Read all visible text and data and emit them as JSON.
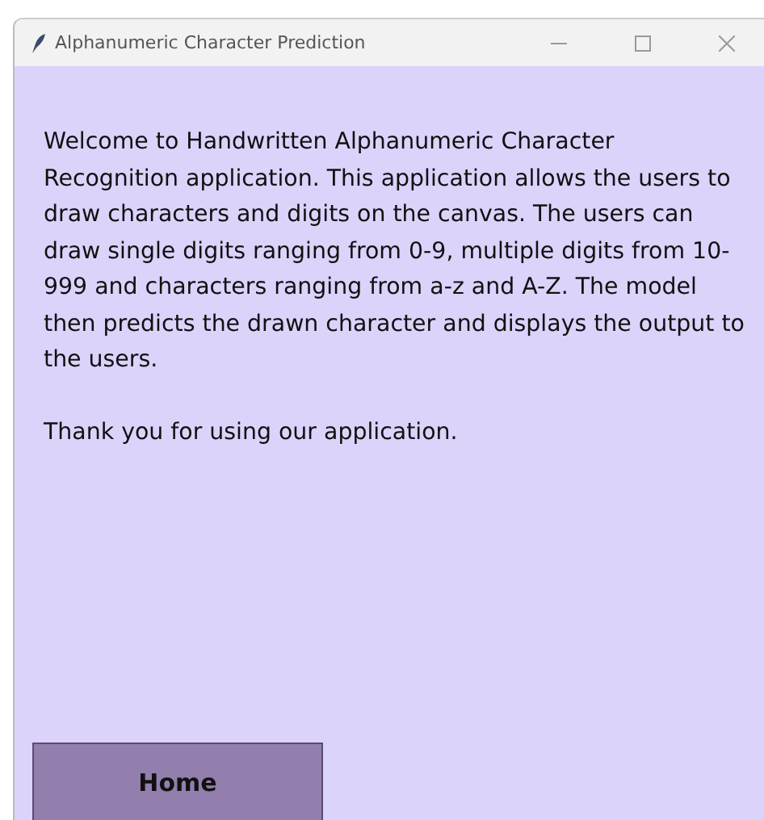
{
  "window": {
    "title": "Alphanumeric Character Prediction"
  },
  "paragraphs": [
    "Welcome to Handwritten Alphanumeric Character Recognition application. This application allows the users to draw characters and digits on the canvas. The users can draw single digits ranging from 0-9, multiple digits from 10-999 and characters ranging from a-z and A-Z. The model then predicts the drawn character and displays the output to the users.",
    "Thank you for using our application."
  ],
  "buttons": [
    {
      "label": "Home"
    }
  ]
}
